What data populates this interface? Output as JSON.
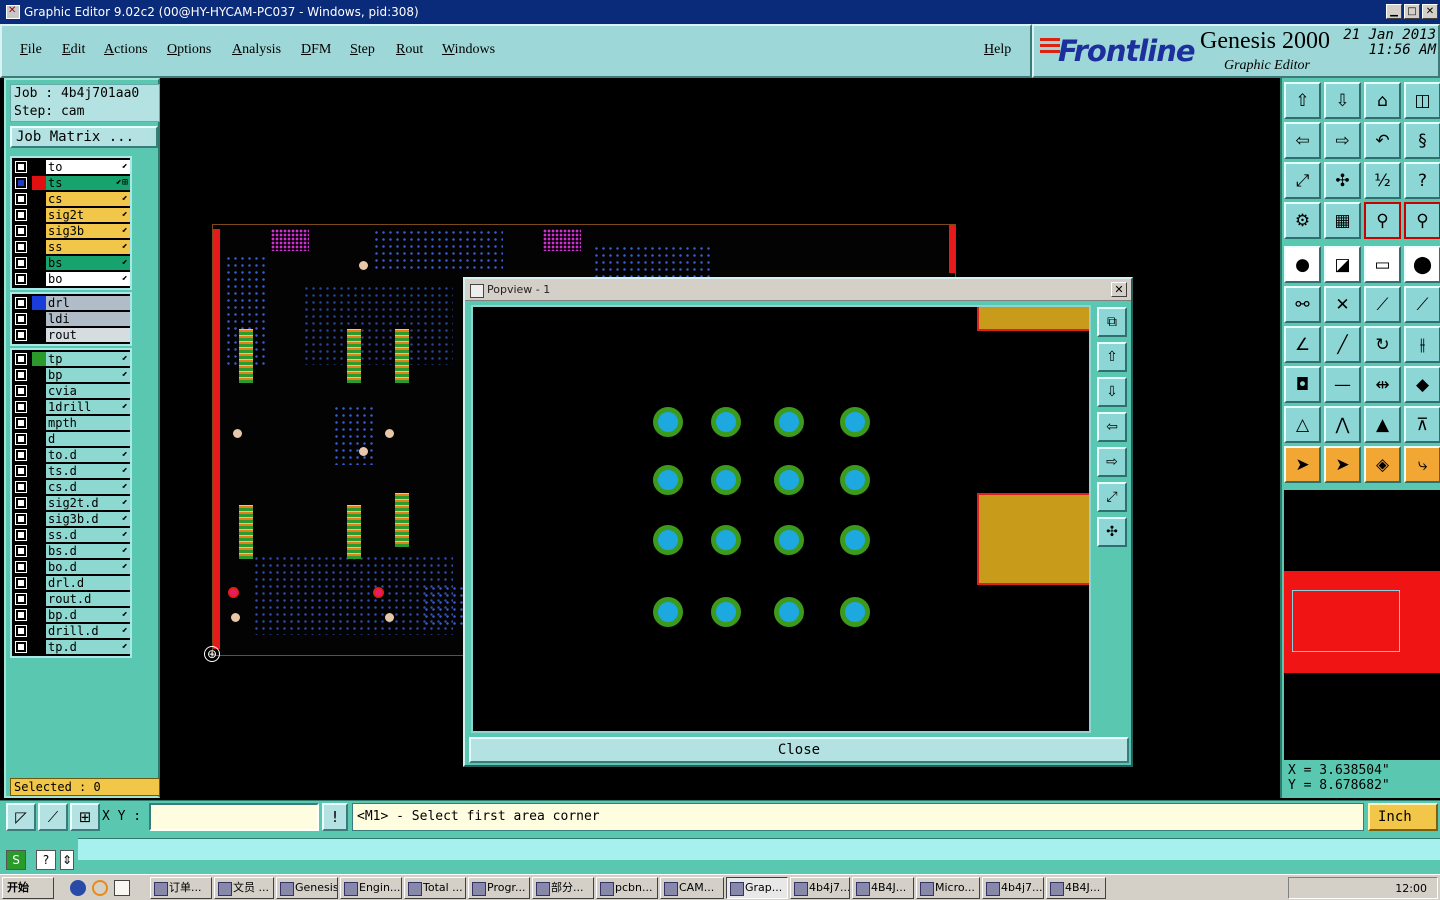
{
  "window": {
    "title": "Graphic Editor 9.02c2 (00@HY-HYCAM-PC037 - Windows, pid:308)"
  },
  "menu": [
    "File",
    "Edit",
    "Actions",
    "Options",
    "Analysis",
    "DFM",
    "Step",
    "Rout",
    "Windows"
  ],
  "help_label": "Help",
  "brand": {
    "logo": "Frontline",
    "product": "Genesis 2000",
    "subtitle": "Graphic Editor",
    "date": "21 Jan 2013",
    "time": "11:56 AM"
  },
  "job": {
    "job_line": "Job : 4b4j701aa0",
    "step_line": "Step: cam",
    "matrix_button": "Job Matrix ..."
  },
  "layers": [
    [
      {
        "name": "to",
        "color": "#000000",
        "bg": "#ffffff",
        "mark": "⬋",
        "checked": false
      },
      {
        "name": "ts",
        "color": "#e01010",
        "bg": "#17a36d",
        "mark": "⬋⊞",
        "checked": true
      },
      {
        "name": "cs",
        "color": "#000000",
        "bg": "#f2c649",
        "mark": "⬋",
        "checked": false
      },
      {
        "name": "sig2t",
        "color": "#000000",
        "bg": "#f2c649",
        "mark": "⬋",
        "checked": false
      },
      {
        "name": "sig3b",
        "color": "#000000",
        "bg": "#f2c649",
        "mark": "⬋",
        "checked": false
      },
      {
        "name": "ss",
        "color": "#000000",
        "bg": "#f2c649",
        "mark": "⬋",
        "checked": false
      },
      {
        "name": "bs",
        "color": "#000000",
        "bg": "#17a36d",
        "mark": "⬋",
        "checked": false
      },
      {
        "name": "bo",
        "color": "#000000",
        "bg": "#ffffff",
        "mark": "⬋",
        "checked": false
      }
    ],
    [
      {
        "name": "drl",
        "color": "#1a3cd8",
        "bg": "#b0bcc8",
        "mark": "",
        "checked": false
      },
      {
        "name": "ldi",
        "color": "#000000",
        "bg": "#b0bcc8",
        "mark": "",
        "checked": false
      },
      {
        "name": "rout",
        "color": "#000000",
        "bg": "#d6dde0",
        "mark": "",
        "checked": false
      }
    ],
    [
      {
        "name": "tp",
        "color": "#2a9a2a",
        "bg": "#8dd8d0",
        "mark": "⬋",
        "checked": false
      },
      {
        "name": "bp",
        "color": "#000000",
        "bg": "#8dd8d0",
        "mark": "⬋",
        "checked": false
      },
      {
        "name": "cvia",
        "color": "#000000",
        "bg": "#8dd8d0",
        "mark": "",
        "checked": false
      },
      {
        "name": "1drill",
        "color": "#000000",
        "bg": "#8dd8d0",
        "mark": "⬋",
        "checked": false
      },
      {
        "name": "mpth",
        "color": "#000000",
        "bg": "#8dd8d0",
        "mark": "",
        "checked": false
      },
      {
        "name": "d",
        "color": "#000000",
        "bg": "#8dd8d0",
        "mark": "",
        "checked": false
      },
      {
        "name": "to.d",
        "color": "#000000",
        "bg": "#8dd8d0",
        "mark": "⬋",
        "checked": false
      },
      {
        "name": "ts.d",
        "color": "#000000",
        "bg": "#8dd8d0",
        "mark": "⬋",
        "checked": false
      },
      {
        "name": "cs.d",
        "color": "#000000",
        "bg": "#8dd8d0",
        "mark": "⬋",
        "checked": false
      },
      {
        "name": "sig2t.d",
        "color": "#000000",
        "bg": "#8dd8d0",
        "mark": "⬋",
        "checked": false
      },
      {
        "name": "sig3b.d",
        "color": "#000000",
        "bg": "#8dd8d0",
        "mark": "⬋",
        "checked": false
      },
      {
        "name": "ss.d",
        "color": "#000000",
        "bg": "#8dd8d0",
        "mark": "⬋",
        "checked": false
      },
      {
        "name": "bs.d",
        "color": "#000000",
        "bg": "#8dd8d0",
        "mark": "⬋",
        "checked": false
      },
      {
        "name": "bo.d",
        "color": "#000000",
        "bg": "#8dd8d0",
        "mark": "⬋",
        "checked": false
      },
      {
        "name": "drl.d",
        "color": "#000000",
        "bg": "#8dd8d0",
        "mark": "",
        "checked": false
      },
      {
        "name": "rout.d",
        "color": "#000000",
        "bg": "#8dd8d0",
        "mark": "",
        "checked": false
      },
      {
        "name": "bp.d",
        "color": "#000000",
        "bg": "#8dd8d0",
        "mark": "⬋",
        "checked": false
      },
      {
        "name": "drill.d",
        "color": "#000000",
        "bg": "#8dd8d0",
        "mark": "⬋",
        "checked": false
      },
      {
        "name": "tp.d",
        "color": "#000000",
        "bg": "#8dd8d0",
        "mark": "⬋",
        "checked": false
      }
    ]
  ],
  "selected_label": "Selected : 0",
  "popview": {
    "title": "Popview - 1",
    "close_label": "Close"
  },
  "coords": {
    "x": "X = 3.638504\"",
    "y": "Y = 8.678682\""
  },
  "command": {
    "xy_label": "X Y :",
    "xy_value": "",
    "prompt": "<M1> - Select first area corner",
    "units": "Inch"
  },
  "taskbar": {
    "start": "开始",
    "tasks": [
      "订单...",
      "文员 ...",
      "Genesis",
      "Engin...",
      "Total ...",
      "Progr...",
      "部分...",
      "pcbn...",
      "CAM...",
      "Grap...",
      "4b4j7...",
      "4B4J...",
      "Micro...",
      "4b4j7...",
      "4B4J..."
    ],
    "active_task": 9,
    "clock": "12:00"
  },
  "colors": {
    "panel_teal": "#5ac8b0",
    "button_cyan": "#b4e2e2",
    "accent_yellow": "#f2c649",
    "via_blue": "#1ea8e0",
    "via_ring_green": "#3c9a1c",
    "pad_gold": "#c89b1a",
    "board_edge_red": "#e61a1a"
  }
}
